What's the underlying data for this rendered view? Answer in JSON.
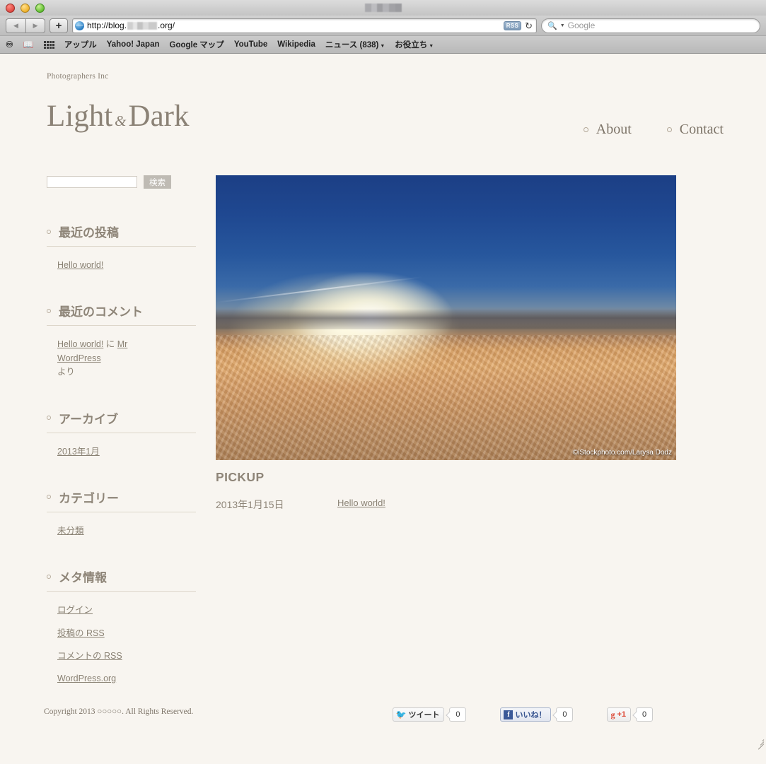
{
  "browser": {
    "window_title_redacted": true,
    "url": {
      "prefix": "http://blog.",
      "suffix": ".org/",
      "redacted": true
    },
    "rss_label": "RSS",
    "reload_icon": "reload-icon",
    "search_placeholder": "Google",
    "back_icon": "back-arrow-icon",
    "forward_icon": "forward-arrow-icon",
    "new_tab_label": "+",
    "bookmarks": [
      {
        "label": "アップル",
        "has_caret": false
      },
      {
        "label": "Yahoo! Japan",
        "has_caret": false
      },
      {
        "label": "Google マップ",
        "has_caret": false
      },
      {
        "label": "YouTube",
        "has_caret": false
      },
      {
        "label": "Wikipedia",
        "has_caret": false
      },
      {
        "label": "ニュース (838)",
        "has_caret": true
      },
      {
        "label": "お役立ち",
        "has_caret": true
      }
    ]
  },
  "site": {
    "tagline": "Photographers Inc",
    "title_part1": "Light",
    "title_amp": "&",
    "title_part2": "Dark",
    "nav": [
      {
        "label": "About"
      },
      {
        "label": "Contact"
      }
    ]
  },
  "sidebar": {
    "search": {
      "value": "",
      "placeholder": "",
      "button_label": "検索"
    },
    "widgets": [
      {
        "title": "最近の投稿",
        "items": [
          {
            "text": "Hello world!",
            "link": true
          }
        ]
      },
      {
        "title": "最近のコメント",
        "items": [
          {
            "text": "Hello world! に Mr WordPress より",
            "link": true
          }
        ]
      },
      {
        "title": "アーカイブ",
        "items": [
          {
            "text": "2013年1月",
            "link": true
          }
        ]
      },
      {
        "title": "カテゴリー",
        "items": [
          {
            "text": "未分類",
            "link": true
          }
        ]
      },
      {
        "title": "メタ情報",
        "items": [
          {
            "text": "ログイン",
            "link": true
          },
          {
            "text": "投稿の RSS",
            "link": true
          },
          {
            "text": "コメントの RSS",
            "link": true
          },
          {
            "text": "WordPress.org",
            "link": true
          }
        ]
      }
    ],
    "comment_parts": {
      "post": "Hello world!",
      "particle": " に ",
      "author": "Mr WordPress",
      "suffix": "より"
    }
  },
  "main": {
    "hero_credit": "©iStockphoto.com/Larysa Dodz",
    "pickup_heading": "PICKUP",
    "post": {
      "date": "2013年1月15日",
      "title": "Hello world!"
    }
  },
  "footer": {
    "copyright": "Copyright 2013 ○○○○○. All Rights Reserved.",
    "social": [
      {
        "name": "twitter",
        "label": "ツイート",
        "count": "0"
      },
      {
        "name": "facebook",
        "label": "いいね！",
        "count": "0"
      },
      {
        "name": "googleplus",
        "label": "+1",
        "count": "0"
      }
    ]
  },
  "colors": {
    "page_background": "#f8f5f0",
    "text_brown": "#8a8274",
    "heading_brown": "#8e8578",
    "rule": "#ddd6ca",
    "search_button": "#bfbbb4"
  }
}
